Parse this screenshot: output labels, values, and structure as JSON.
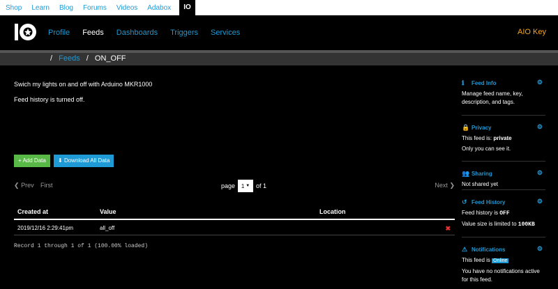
{
  "topnav": {
    "items": [
      "Shop",
      "Learn",
      "Blog",
      "Forums",
      "Videos",
      "Adabox"
    ],
    "io_label": "IO"
  },
  "header": {
    "nav": [
      "Profile",
      "Feeds",
      "Dashboards",
      "Triggers",
      "Services"
    ],
    "active": "Feeds",
    "aio_key": "AIO Key"
  },
  "breadcrumb": {
    "feeds": "Feeds",
    "current": "ON_OFF"
  },
  "feed": {
    "description": "Swich my lights on and off with Arduino MKR1000",
    "history_message": "Feed history is turned off."
  },
  "buttons": {
    "add": "+ Add Data",
    "download": "Download All Data"
  },
  "pager": {
    "prev": "Prev",
    "first": "First",
    "page_label": "page",
    "page_value": "1",
    "of_label": "of 1",
    "next": "Next"
  },
  "table": {
    "headers": [
      "Created at",
      "Value",
      "Location"
    ],
    "rows": [
      {
        "created": "2019/12/16 2:29:41pm",
        "value": "all_off",
        "location": ""
      }
    ],
    "records": "Record 1 through 1 of 1 (100.00% loaded)"
  },
  "sidebar": {
    "feed_info": {
      "title": "Feed Info",
      "text": "Manage feed name, key, description, and tags."
    },
    "privacy": {
      "title": "Privacy",
      "text_prefix": "This feed is: ",
      "value": "private",
      "text2": "Only you can see it."
    },
    "sharing": {
      "title": "Sharing",
      "text": "Not shared yet"
    },
    "feed_history": {
      "title": "Feed History",
      "text_prefix": "Feed history is ",
      "value": "OFF",
      "text2_prefix": "Value size is limited to ",
      "value2": "100KB"
    },
    "notifications": {
      "title": "Notifications",
      "text_prefix": "This feed is ",
      "badge": "Online",
      "text2": "You have no notifications active for this feed."
    }
  },
  "colors": {
    "accent": "#1e9ad6",
    "add_button": "#58b947",
    "aio_key": "#f5a623",
    "delete": "#ee3333"
  }
}
